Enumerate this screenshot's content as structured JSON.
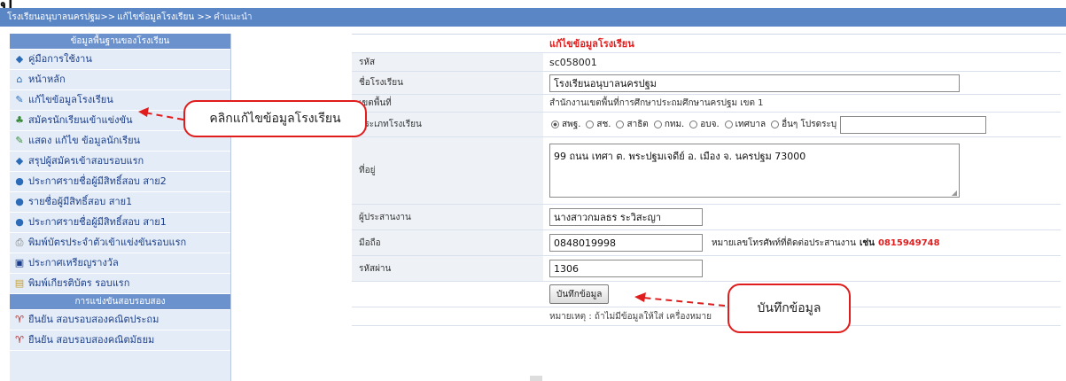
{
  "header": {
    "breadcrumb_part1": "โรงเรียนอนุบาลนครปฐม>>",
    "breadcrumb_part2": "แก้ไขข้อมูลโรงเรียน >>",
    "breadcrumb_current": "คำแนะนำ"
  },
  "sidebar": {
    "section1_title": "ข้อมูลพื้นฐานของโรงเรียน",
    "section2_title": "การแข่งขันสอบรอบสอง",
    "items": [
      {
        "label": "คู่มือการใช้งาน",
        "icon": "book-icon"
      },
      {
        "label": "หน้าหลัก",
        "icon": "home-icon"
      },
      {
        "label": "แก้ไขข้อมูลโรงเรียน",
        "icon": "edit-icon"
      },
      {
        "label": "สมัครนักเรียนเข้าแข่งขัน",
        "icon": "users-icon"
      },
      {
        "label": "แสดง แก้ไข ข้อมูลนักเรียน",
        "icon": "edit-icon"
      },
      {
        "label": "สรุปผู้สมัครเข้าสอบรอบแรก",
        "icon": "summary-icon"
      },
      {
        "label": "ประกาศรายชื่อผู้มีสิทธิ์สอบ สาย2",
        "icon": "globe-icon"
      },
      {
        "label": "รายชื่อผู้มีสิทธิ์สอบ สาย1",
        "icon": "globe-icon"
      },
      {
        "label": "ประกาศรายชื่อผู้มีสิทธิ์สอบ สาย1",
        "icon": "globe-icon"
      },
      {
        "label": "พิมพ์บัตรประจำตัวเข้าแข่งขันรอบแรก",
        "icon": "print-icon"
      },
      {
        "label": "ประกาศเหรียญรางวัล",
        "icon": "medal-icon"
      },
      {
        "label": "พิมพ์เกียรติบัตร รอบแรก",
        "icon": "certificate-icon"
      }
    ],
    "items2": [
      {
        "label": "ยืนยัน สอบรอบสองคณิตประถม",
        "icon": "pin-icon"
      },
      {
        "label": "ยืนยัน สอบรอบสองคณิตมัธยม",
        "icon": "pin-icon"
      }
    ]
  },
  "form": {
    "title": "แก้ไขข้อมูลโรงเรียน",
    "code_label": "รหัส",
    "code_value": "sc058001",
    "name_label": "ชื่อโรงเรียน",
    "name_value": "โรงเรียนอนุบาลนครปฐม",
    "area_label": "เขตพื้นที่",
    "area_value": "สำนักงานเขตพื้นที่การศึกษาประถมศึกษานครปฐม เขต 1",
    "type_label": "ประเภทโรงเรียน",
    "type_options": [
      "สพฐ.",
      "สช.",
      "สาธิต",
      "กทม.",
      "อบจ.",
      "เทศบาล",
      "อื่นๆ โปรดระบุ"
    ],
    "type_selected": "สพฐ.",
    "address_label": "ที่อยู่",
    "address_value": "99  ถนน เทศา   ต. พระปฐมเจดีย์   อ. เมือง   จ. นครปฐม   73000",
    "coordinator_label": "ผู้ประสานงาน",
    "coordinator_value": "นางสาวกมลธร  ระวิสะญา",
    "mobile_label": "มือถือ",
    "mobile_value": "0848019998",
    "mobile_hint": "หมายเลขโทรศัพท์ที่ติดต่อประสานงาน",
    "mobile_example_prefix": "เช่น",
    "mobile_example": "0815949748",
    "password_label": "รหัสผ่าน",
    "password_value": "1306",
    "save_button": "บันทึกข้อมูล",
    "note": "หมายเหตุ : ถ้าไม่มีข้อมูลให้ใส่ เครื่องหมาย"
  },
  "annotations": {
    "callout1": "คลิกแก้ไขข้อมูลโรงเรียน",
    "callout2": "บันทึกข้อมูล",
    "color": "#e01c1c"
  }
}
